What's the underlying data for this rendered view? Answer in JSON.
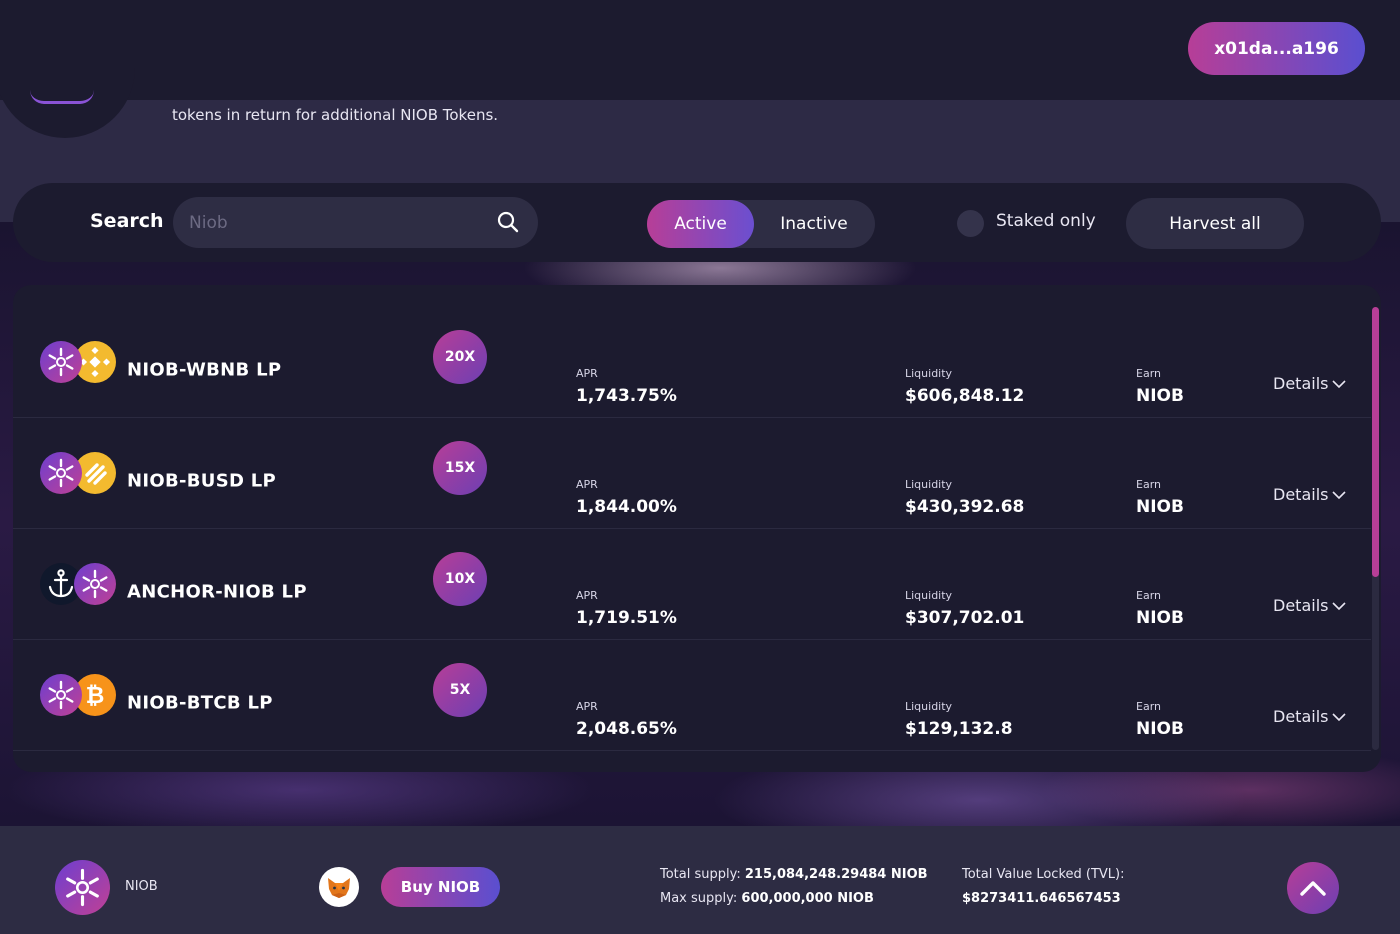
{
  "header": {
    "wallet_address": "x01da...a196",
    "intro_text": "tokens in return for additional NIOB Tokens."
  },
  "filters": {
    "search_label": "Search",
    "search_placeholder": "Niob",
    "active_label": "Active",
    "inactive_label": "Inactive",
    "staked_only_label": "Staked only",
    "harvest_all_label": "Harvest all"
  },
  "farms": [
    {
      "name": "NIOB-WBNB LP",
      "multiplier": "20X",
      "apr_label": "APR",
      "apr": "1,743.75%",
      "liquidity_label": "Liquidity",
      "liquidity": "$606,848.12",
      "earn_label": "Earn",
      "earn": "NIOB",
      "details_label": "Details",
      "tokens": [
        "niob-icon",
        "bnb-icon"
      ]
    },
    {
      "name": "NIOB-BUSD LP",
      "multiplier": "15X",
      "apr_label": "APR",
      "apr": "1,844.00%",
      "liquidity_label": "Liquidity",
      "liquidity": "$430,392.68",
      "earn_label": "Earn",
      "earn": "NIOB",
      "details_label": "Details",
      "tokens": [
        "niob-icon",
        "busd-icon"
      ]
    },
    {
      "name": "ANCHOR-NIOB LP",
      "multiplier": "10X",
      "apr_label": "APR",
      "apr": "1,719.51%",
      "liquidity_label": "Liquidity",
      "liquidity": "$307,702.01",
      "earn_label": "Earn",
      "earn": "NIOB",
      "details_label": "Details",
      "tokens": [
        "anchor-icon",
        "niob-icon"
      ]
    },
    {
      "name": "NIOB-BTCB LP",
      "multiplier": "5X",
      "apr_label": "APR",
      "apr": "2,048.65%",
      "liquidity_label": "Liquidity",
      "liquidity": "$129,132.8",
      "earn_label": "Earn",
      "earn": "NIOB",
      "details_label": "Details",
      "tokens": [
        "niob-icon",
        "btcb-icon"
      ]
    }
  ],
  "footer": {
    "token_label": "NIOB",
    "buy_label": "Buy NIOB",
    "total_supply_label": "Total supply:",
    "total_supply": "215,084,248.29484 NIOB",
    "max_supply_label": "Max supply:",
    "max_supply": "600,000,000 NIOB",
    "tvl_label": "Total Value Locked (TVL):",
    "tvl": "$8273411.646567453"
  },
  "colors": {
    "accent_pink": "#b73e97",
    "accent_purple": "#5a4fd0",
    "panel": "#1c1b2f",
    "field": "#2e2d44",
    "bnb": "#f3ba2f",
    "btc": "#f7931a"
  }
}
